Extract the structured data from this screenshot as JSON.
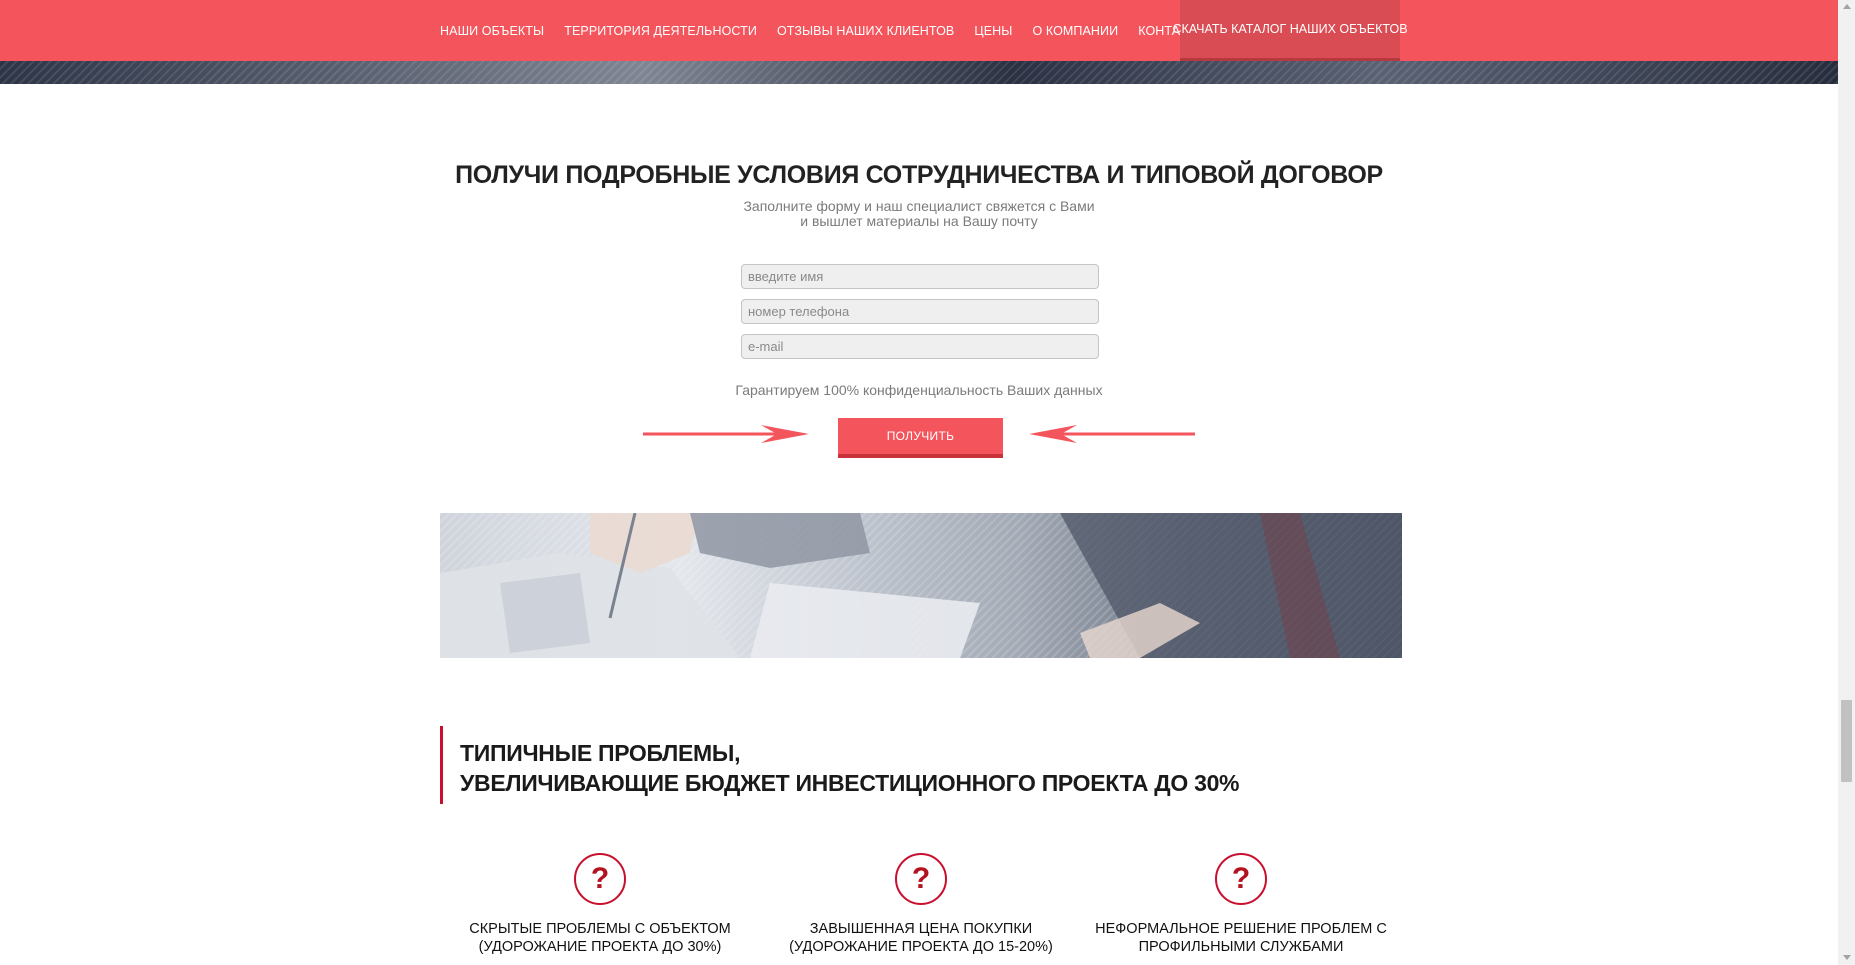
{
  "nav": {
    "items": [
      {
        "label": "НАШИ ОБЪЕКТЫ"
      },
      {
        "label": "ТЕРРИТОРИЯ ДЕЯТЕЛЬНОСТИ"
      },
      {
        "label": "ОТЗЫВЫ НАШИХ КЛИЕНТОВ"
      },
      {
        "label": "ЦЕНЫ"
      },
      {
        "label": "О КОМПАНИИ"
      },
      {
        "label": "КОНТАКТЫ"
      }
    ],
    "cta_label": "СКАЧАТЬ КАТАЛОГ НАШИХ ОБЪЕКТОВ"
  },
  "form": {
    "title": "ПОЛУЧИ ПОДРОБНЫЕ УСЛОВИЯ СОТРУДНИЧЕСТВА И ТИПОВОЙ ДОГОВОР",
    "subtitle_line1": "Заполните форму и наш специалист свяжется с Вами",
    "subtitle_line2": "и вышлет материалы на Вашу почту",
    "name_placeholder": "введите имя",
    "phone_placeholder": "номер телефона",
    "email_placeholder": "e-mail",
    "name_value": "",
    "phone_value": "",
    "email_value": "",
    "privacy": "Гарантируем 100% конфиденциальность Ваших данных",
    "submit_label": "ПОЛУЧИТЬ"
  },
  "problems": {
    "title_line1": "ТИПИЧНЫЕ ПРОБЛЕМЫ,",
    "title_line2": "УВЕЛИЧИВАЮЩИЕ БЮДЖЕТ ИНВЕСТИЦИОННОГО ПРОЕКТА ДО 30%",
    "items": [
      {
        "icon": "question-icon",
        "symbol": "?",
        "line1": "СКРЫТЫЕ ПРОБЛЕМЫ С ОБЪЕКТОМ",
        "line2": "(УДОРОЖАНИЕ ПРОЕКТА ДО 30%)"
      },
      {
        "icon": "question-icon",
        "symbol": "?",
        "line1": "ЗАВЫШЕННАЯ ЦЕНА ПОКУПКИ",
        "line2": "(УДОРОЖАНИЕ ПРОЕКТА ДО 15-20%)"
      },
      {
        "icon": "question-icon",
        "symbol": "?",
        "line1": "НЕФОРМАЛЬНОЕ РЕШЕНИЕ ПРОБЛЕМ С",
        "line2": "ПРОФИЛЬНЫМИ СЛУЖБАМИ"
      }
    ]
  },
  "colors": {
    "accent": "#f4555c",
    "accent_dark": "#c8102e",
    "muted_text": "#7b7b7b"
  }
}
